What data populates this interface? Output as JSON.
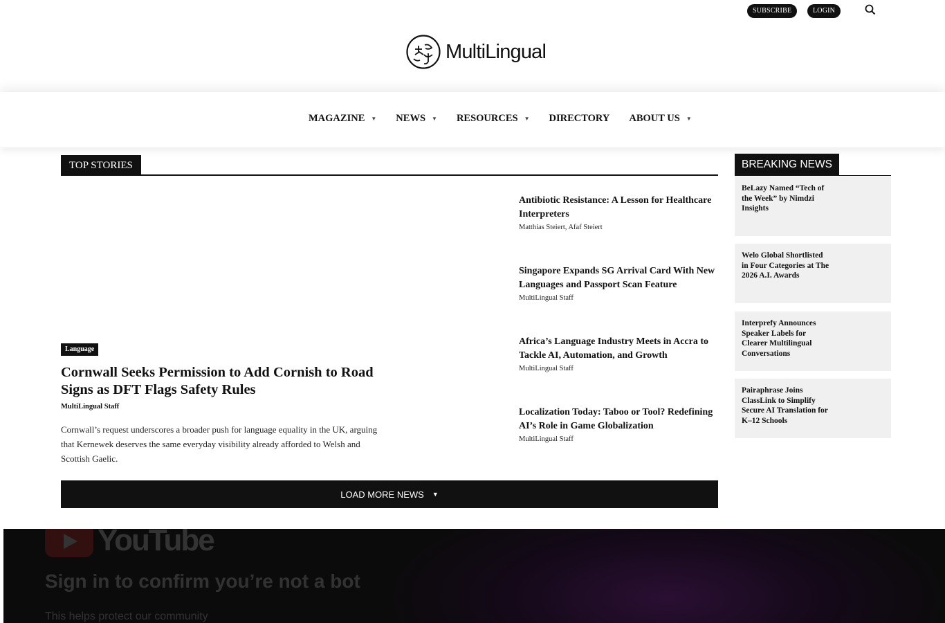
{
  "header": {
    "subscribe_label": "SUBSCRIBE",
    "login_label": "LOGIN",
    "search_icon": "search-icon",
    "logo_text": "MultiLingual"
  },
  "nav": {
    "items": [
      {
        "label": "MAGAZINE",
        "has_dropdown": true
      },
      {
        "label": "NEWS",
        "has_dropdown": true
      },
      {
        "label": "RESOURCES",
        "has_dropdown": true
      },
      {
        "label": "DIRECTORY",
        "has_dropdown": false
      },
      {
        "label": "ABOUT US",
        "has_dropdown": true
      }
    ]
  },
  "top_stories": {
    "label": "TOP STORIES",
    "featured": {
      "tag": "Language",
      "title": "Cornwall Seeks Permission to Add Cornish to Road Signs as DFT Flags Safety Rules",
      "author": "MultiLingual Staff",
      "excerpt": "Cornwall’s request underscores a broader push for language equality in the UK, arguing that Kernewek deserves the same everyday visibility already afforded to Welsh and Scottish Gaelic."
    },
    "stories": [
      {
        "title": "Antibiotic Resistance: A Lesson for Healthcare Interpreters",
        "author": "Matthias Steiert, Afaf Steiert"
      },
      {
        "title": "Singapore Expands SG Arrival Card With New Languages and Passport Scan Feature",
        "author": "MultiLingual Staff"
      },
      {
        "title": "Africa’s Language Industry Meets in Accra to Tackle AI, Automation, and Growth",
        "author": "MultiLingual Staff"
      },
      {
        "title": "Localization Today: Taboo or Tool? Redefining AI’s Role in Game Globalization",
        "author": "MultiLingual Staff"
      }
    ],
    "load_more_label": "LOAD MORE NEWS"
  },
  "breaking_news": {
    "label": "BREAKING NEWS",
    "items": [
      {
        "title": "BeLazy Named “Tech of the Week” by Nimdzi Insights"
      },
      {
        "title": "Welo Global Shortlisted in Four Categories at The 2026 A.I. Awards"
      },
      {
        "title": "Interprefy Announces Speaker Labels for Clearer Multilingual Conversations"
      },
      {
        "title": "Pairaphrase Joins ClassLink to Simplify Secure AI Translation for K–12 Schools"
      }
    ]
  },
  "youtube_embed": {
    "brand": "YouTube",
    "heading": "Sign in to confirm you’re not a bot",
    "subtext": "This helps protect our community"
  },
  "colors": {
    "primary": "#111111",
    "card_bg": "#f0f0f0",
    "yt_red": "#ff2a2a"
  }
}
